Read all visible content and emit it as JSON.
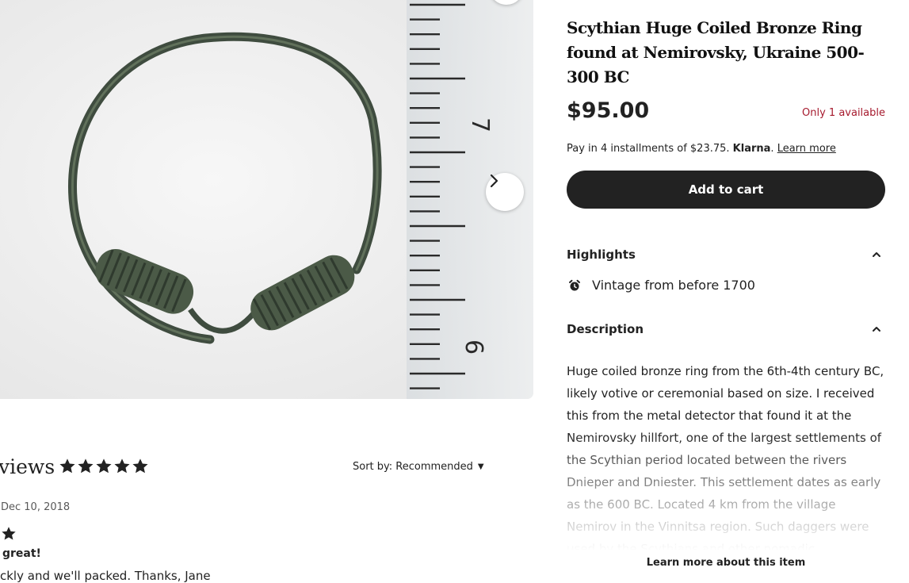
{
  "product": {
    "title": "Scythian Huge Coiled Bronze Ring found at Nemirovsky, Ukraine 500-300 BC",
    "price": "$95.00",
    "availability": "Only 1 available",
    "installments": {
      "prefix": "Pay in 4 installments of $23.75.",
      "provider": "Klarna",
      "link": "Learn more"
    },
    "add_to_cart": "Add to cart"
  },
  "highlights": {
    "heading": "Highlights",
    "items": [
      {
        "icon": "alarm-clock-icon",
        "text": "Vintage from before 1700"
      }
    ]
  },
  "description": {
    "heading": "Description",
    "text": "Huge coiled bronze ring from the 6th-4th century BC, likely votive or ceremonial based on size. I received this from the metal detector that found it at the Nemirovsky hillfort, one of the largest settlements of the Scythian period located between the rivers Dnieper and Dniester. This settlement dates as early as the 600 BC. Located 4 km from the village Nemirov in the Vinnitsa region. Such daggers were used by the Scythians and other nomadic",
    "learn_more": "Learn more about this item"
  },
  "gallery": {
    "next_icon": "chevron-right-icon",
    "ruler_labels": [
      "7",
      "6"
    ]
  },
  "reviews": {
    "title": "views",
    "rating": 5,
    "sort_label": "Sort by: Recommended",
    "latest": {
      "date": "Dec 10, 2018",
      "rating": 1,
      "heading": "great!",
      "body": "ckly and we'll packed. Thanks, Jane"
    }
  },
  "colors": {
    "accent_dark": "#222222",
    "availability": "#a61a2e",
    "photo_bg": "#f1f1f1"
  }
}
